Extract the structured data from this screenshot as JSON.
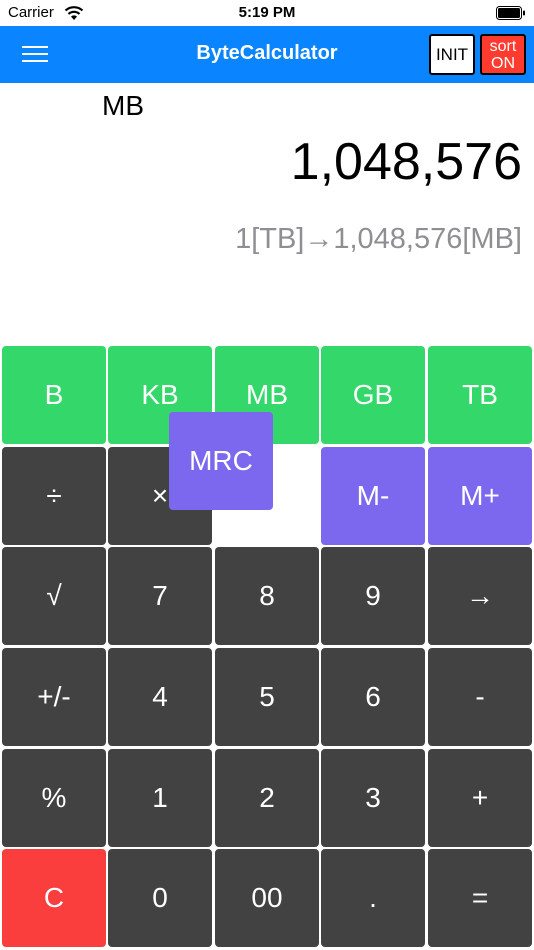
{
  "status_bar": {
    "carrier": "Carrier",
    "time": "5:19 PM"
  },
  "nav": {
    "title": "ByteCalculator",
    "init_label": "INIT",
    "sort_label_line1": "sort",
    "sort_label_line2": "ON",
    "accent_color": "#0a84ff"
  },
  "display": {
    "unit": "MB",
    "value": "1,048,576",
    "conversion": "1[TB]→1,048,576[MB]"
  },
  "keypad": {
    "units": [
      "B",
      "KB",
      "MB",
      "GB",
      "TB"
    ],
    "row2": [
      "÷",
      "×",
      "M-",
      "M+"
    ],
    "row3": [
      "√",
      "7",
      "8",
      "9",
      "→"
    ],
    "row4": [
      "+/-",
      "4",
      "5",
      "6",
      "-"
    ],
    "row5": [
      "%",
      "1",
      "2",
      "3",
      "+"
    ],
    "row6": [
      "C",
      "0",
      "00",
      ".",
      "="
    ],
    "mrc": "MRC",
    "colors": {
      "unit_key": "#34d76a",
      "memory_key": "#7b68ee",
      "number_key": "#424242",
      "clear_key": "#fa3e3e"
    }
  }
}
